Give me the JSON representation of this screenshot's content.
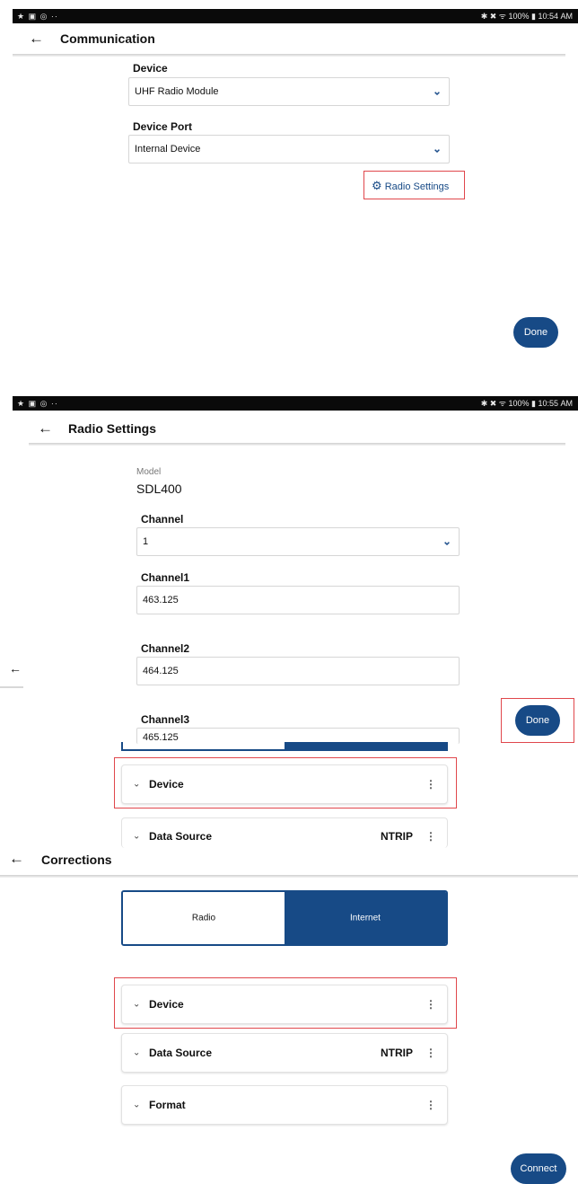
{
  "colors": {
    "accent": "#174a86",
    "highlight_border": "#e0474c",
    "status_bar": "#0a0a0a"
  },
  "panel1": {
    "status": {
      "left_icons": "★ ▣ ◎ ··",
      "right": "✱ ✖ ᯤ 100% ▮ 10:54 AM"
    },
    "title": "Communication",
    "device_label": "Device",
    "device_value": "UHF Radio Module",
    "port_label": "Device Port",
    "port_value": "Internal Device",
    "radio_settings_label": "Radio Settings",
    "done_label": "Done"
  },
  "panel2": {
    "status": {
      "left_icons": "★ ▣ ◎ ··",
      "right": "✱ ✖ ᯤ 100% ▮ 10:55 AM"
    },
    "title": "Radio Settings",
    "model_label": "Model",
    "model_value": "SDL400",
    "channel_label": "Channel",
    "channel_value": "1",
    "channel1_label": "Channel1",
    "channel1_value": "463.125",
    "channel2_label": "Channel2",
    "channel2_value": "464.125",
    "channel3_label": "Channel3",
    "channel3_value": "465.125",
    "done_label": "Done",
    "overlap_device": "Device",
    "overlap_data_source": "Data Source",
    "overlap_data_source_value": "NTRIP"
  },
  "panel3": {
    "title": "Corrections",
    "tab_radio": "Radio",
    "tab_internet": "Internet",
    "device_label": "Device",
    "data_source_label": "Data Source",
    "data_source_value": "NTRIP",
    "format_label": "Format",
    "connect_label": "Connect"
  }
}
